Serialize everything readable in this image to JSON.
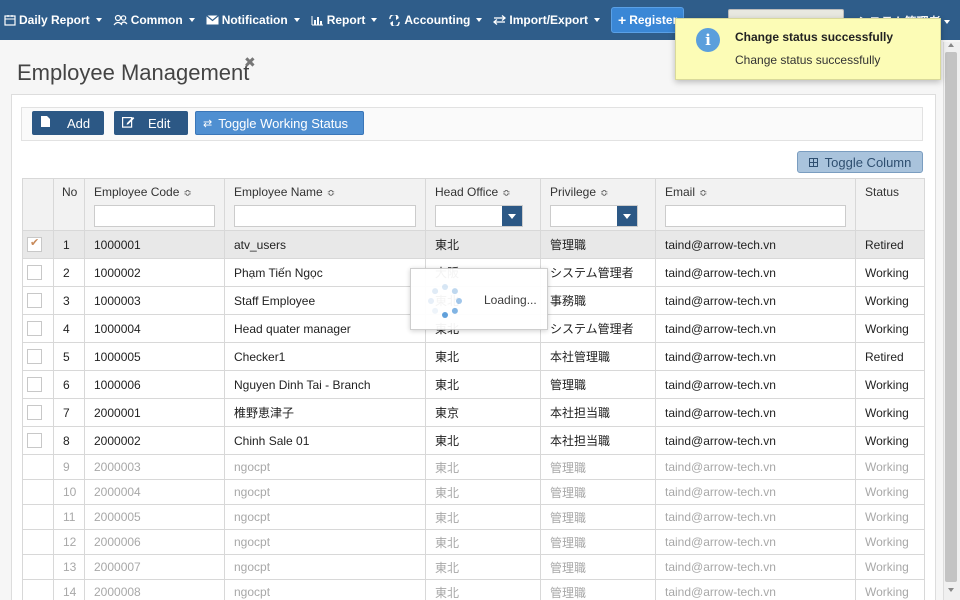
{
  "navbar": {
    "items": [
      {
        "label": "Daily Report",
        "icon": "calendar-icon"
      },
      {
        "label": "Common",
        "icon": "users-icon"
      },
      {
        "label": "Notification",
        "icon": "envelope-icon"
      },
      {
        "label": "Report",
        "icon": "bar-chart-icon"
      },
      {
        "label": "Accounting",
        "icon": "exchange-icon"
      },
      {
        "label": "Import/Export",
        "icon": "swap-icon"
      }
    ],
    "register_label": "Register",
    "user_label": "システム管理者",
    "bg_color": "#2f5d8a"
  },
  "toast": {
    "title": "Change status successfully",
    "message": "Change status successfully",
    "icon": "info-icon"
  },
  "page": {
    "title": "Employee Management",
    "close_glyph": "✖"
  },
  "toolbar": {
    "add_label": "Add",
    "edit_label": "Edit",
    "toggle_status_label": "Toggle Working Status",
    "toggle_column_label": "Toggle Column"
  },
  "table": {
    "headers": {
      "no": "No",
      "code": "Employee Code",
      "name": "Employee Name",
      "office": "Head Office",
      "privilege": "Privilege",
      "email": "Email",
      "status": "Status"
    },
    "rows": [
      {
        "no": "1",
        "code": "1000001",
        "name": "atv_users",
        "office": "東北",
        "privilege": "管理職",
        "email": "taind@arrow-tech.vn",
        "status": "Retired"
      },
      {
        "no": "2",
        "code": "1000002",
        "name": "Phạm Tiến Ngọc",
        "office": "大阪",
        "privilege": "システム管理者",
        "email": "taind@arrow-tech.vn",
        "status": "Working"
      },
      {
        "no": "3",
        "code": "1000003",
        "name": "Staff Employee",
        "office": "東北",
        "privilege": "事務職",
        "email": "taind@arrow-tech.vn",
        "status": "Working"
      },
      {
        "no": "4",
        "code": "1000004",
        "name": "Head quater manager",
        "office": "東北",
        "privilege": "システム管理者",
        "email": "taind@arrow-tech.vn",
        "status": "Working"
      },
      {
        "no": "5",
        "code": "1000005",
        "name": "Checker1",
        "office": "東北",
        "privilege": "本社管理職",
        "email": "taind@arrow-tech.vn",
        "status": "Retired"
      },
      {
        "no": "6",
        "code": "1000006",
        "name": "Nguyen Dinh Tai - Branch",
        "office": "東北",
        "privilege": "管理職",
        "email": "taind@arrow-tech.vn",
        "status": "Working"
      },
      {
        "no": "7",
        "code": "2000001",
        "name": "椎野恵津子",
        "office": "東京",
        "privilege": "本社担当職",
        "email": "taind@arrow-tech.vn",
        "status": "Working"
      },
      {
        "no": "8",
        "code": "2000002",
        "name": "Chinh Sale 01",
        "office": "東北",
        "privilege": "本社担当職",
        "email": "taind@arrow-tech.vn",
        "status": "Working"
      }
    ],
    "dim_rows": [
      {
        "no": "9",
        "code": "2000003",
        "name": "ngocpt",
        "office": "東北",
        "privilege": "管理職",
        "email": "taind@arrow-tech.vn",
        "status": "Working"
      },
      {
        "no": "10",
        "code": "2000004",
        "name": "ngocpt",
        "office": "東北",
        "privilege": "管理職",
        "email": "taind@arrow-tech.vn",
        "status": "Working"
      },
      {
        "no": "11",
        "code": "2000005",
        "name": "ngocpt",
        "office": "東北",
        "privilege": "管理職",
        "email": "taind@arrow-tech.vn",
        "status": "Working"
      },
      {
        "no": "12",
        "code": "2000006",
        "name": "ngocpt",
        "office": "東北",
        "privilege": "管理職",
        "email": "taind@arrow-tech.vn",
        "status": "Working"
      },
      {
        "no": "13",
        "code": "2000007",
        "name": "ngocpt",
        "office": "東北",
        "privilege": "管理職",
        "email": "taind@arrow-tech.vn",
        "status": "Working"
      },
      {
        "no": "14",
        "code": "2000008",
        "name": "ngocpt",
        "office": "東北",
        "privilege": "管理職",
        "email": "taind@arrow-tech.vn",
        "status": "Working"
      }
    ]
  },
  "loading": {
    "text": "Loading..."
  }
}
